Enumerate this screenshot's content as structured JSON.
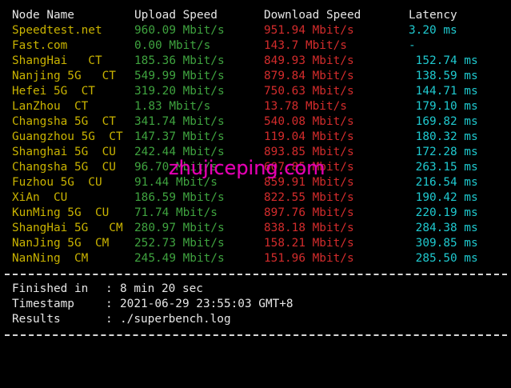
{
  "headers": {
    "node": "Node Name",
    "upload": "Upload Speed",
    "download": "Download Speed",
    "latency": "Latency"
  },
  "rows": [
    {
      "node": "Speedtest.net",
      "upload": "960.09 Mbit/s",
      "download": "951.94 Mbit/s",
      "latency": "3.20 ms"
    },
    {
      "node": "Fast.com",
      "upload": "0.00 Mbit/s",
      "download": "143.7 Mbit/s",
      "latency": "-"
    },
    {
      "node": "ShangHai   CT",
      "upload": "185.36 Mbit/s",
      "download": "849.93 Mbit/s",
      "latency": " 152.74 ms"
    },
    {
      "node": "Nanjing 5G   CT",
      "upload": "549.99 Mbit/s",
      "download": "879.84 Mbit/s",
      "latency": " 138.59 ms"
    },
    {
      "node": "Hefei 5G  CT",
      "upload": "319.20 Mbit/s",
      "download": "750.63 Mbit/s",
      "latency": " 144.71 ms"
    },
    {
      "node": "LanZhou  CT",
      "upload": "1.83 Mbit/s",
      "download": "13.78 Mbit/s",
      "latency": " 179.10 ms"
    },
    {
      "node": "Changsha 5G  CT",
      "upload": "341.74 Mbit/s",
      "download": "540.08 Mbit/s",
      "latency": " 169.82 ms"
    },
    {
      "node": "Guangzhou 5G  CT",
      "upload": "147.37 Mbit/s",
      "download": "119.04 Mbit/s",
      "latency": " 180.32 ms"
    },
    {
      "node": "Shanghai 5G  CU",
      "upload": "242.44 Mbit/s",
      "download": "893.85 Mbit/s",
      "latency": " 172.28 ms"
    },
    {
      "node": "Changsha 5G  CU",
      "upload": "96.70 Mbit/s",
      "download": "607.85 Mbit/s",
      "latency": " 263.15 ms"
    },
    {
      "node": "Fuzhou 5G  CU",
      "upload": "91.44 Mbit/s",
      "download": "859.91 Mbit/s",
      "latency": " 216.54 ms"
    },
    {
      "node": "XiAn  CU",
      "upload": "186.59 Mbit/s",
      "download": "822.55 Mbit/s",
      "latency": " 190.42 ms"
    },
    {
      "node": "KunMing 5G  CU",
      "upload": "71.74 Mbit/s",
      "download": "897.76 Mbit/s",
      "latency": " 220.19 ms"
    },
    {
      "node": "ShangHai 5G   CM",
      "upload": "280.97 Mbit/s",
      "download": "838.18 Mbit/s",
      "latency": " 284.38 ms"
    },
    {
      "node": "NanJing 5G  CM",
      "upload": "252.73 Mbit/s",
      "download": "158.21 Mbit/s",
      "latency": " 309.85 ms"
    },
    {
      "node": "NanNing  CM",
      "upload": "245.49 Mbit/s",
      "download": "151.96 Mbit/s",
      "latency": " 285.50 ms"
    }
  ],
  "summary": {
    "finished_key": "Finished in",
    "finished_value": "8 min 20 sec",
    "timestamp_key": "Timestamp",
    "timestamp_value": "2021-06-29 23:55:03 GMT+8",
    "results_key": "Results",
    "results_value": "./superbench.log",
    "separator": ":"
  },
  "watermark": "zhujiceping.com",
  "colors": {
    "header": "#e6e6e6",
    "node": "#c9b300",
    "upload": "#3fa33f",
    "download": "#d32c2c",
    "latency": "#1fc9cf",
    "watermark": "#e600b4",
    "background": "#000000"
  }
}
